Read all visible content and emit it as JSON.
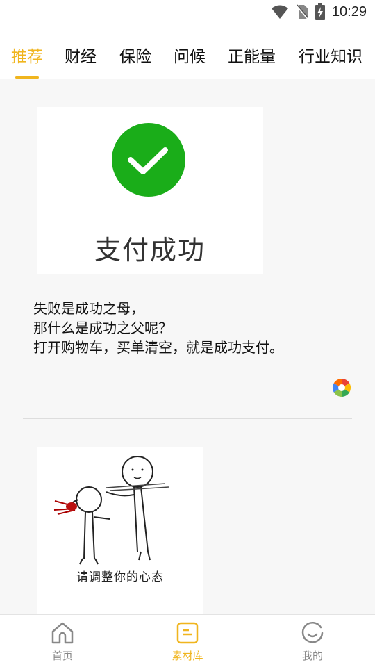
{
  "status_bar": {
    "time": "10:29",
    "icons": [
      "wifi-icon",
      "no-sim-icon",
      "battery-charging-icon"
    ]
  },
  "tabs": [
    {
      "label": "推荐",
      "active": true
    },
    {
      "label": "财经",
      "active": false
    },
    {
      "label": "保险",
      "active": false
    },
    {
      "label": "问候",
      "active": false
    },
    {
      "label": "正能量",
      "active": false
    },
    {
      "label": "行业知识",
      "active": false
    }
  ],
  "feed": {
    "post1": {
      "image_text": "支付成功",
      "text_lines": [
        "失败是成功之母，",
        "那什么是成功之父呢？",
        "打开购物车，买单清空，就是成功支付。"
      ],
      "share_icon": "colorful-shutter-icon"
    },
    "post2": {
      "image_caption": "请调整你的心态"
    }
  },
  "bottom_nav": [
    {
      "label": "首页",
      "icon": "home-icon",
      "active": false
    },
    {
      "label": "素材库",
      "icon": "library-icon",
      "active": true
    },
    {
      "label": "我的",
      "icon": "profile-smile-icon",
      "active": false
    }
  ],
  "colors": {
    "accent": "#f0b51e",
    "success_green": "#1aad19",
    "background": "#f7f7f7"
  }
}
